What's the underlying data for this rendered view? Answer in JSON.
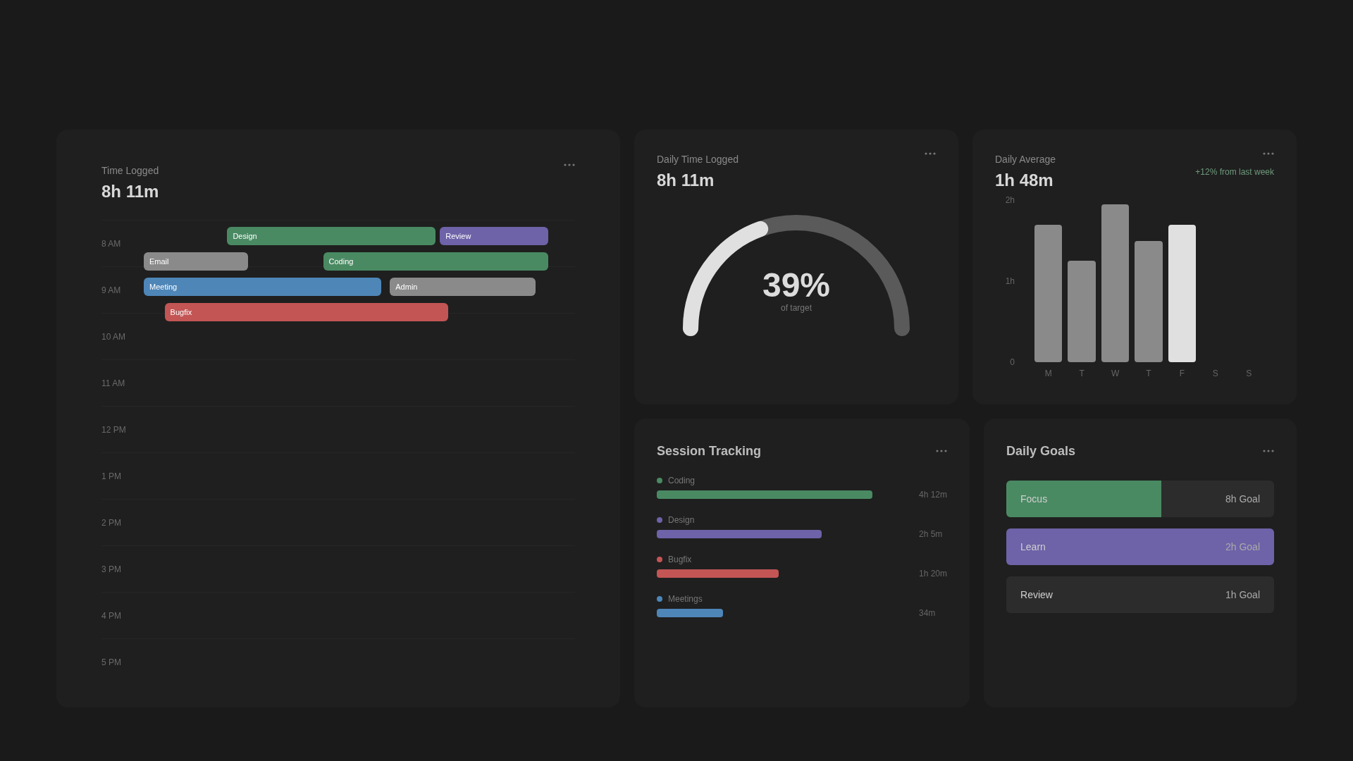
{
  "timeline": {
    "label": "Time Logged",
    "value": "8h 11m",
    "hours": [
      "8 AM",
      "9 AM",
      "10 AM",
      "11 AM",
      "12 PM",
      "1 PM",
      "2 PM",
      "3 PM",
      "4 PM",
      "5 PM"
    ],
    "rows": [
      {
        "events": [
          {
            "label": "Design",
            "color": "#4a8a63"
          },
          {
            "label": "Review",
            "color": "#6e62a8"
          }
        ]
      },
      {
        "events": [
          {
            "label": "Email",
            "color": "#8a8a8a"
          },
          {
            "label": "Coding",
            "color": "#4a8a63"
          }
        ]
      },
      {
        "events": [
          {
            "label": "Meeting",
            "color": "#4e86b8"
          },
          {
            "label": "Admin",
            "color": "#8a8a8a"
          }
        ]
      },
      {
        "events": [
          {
            "label": "Bugfix",
            "color": "#c35555"
          }
        ]
      }
    ]
  },
  "gauge": {
    "label": "Daily Time Logged",
    "value": "8h 11m",
    "percent": "39%",
    "caption": "of target"
  },
  "average": {
    "label": "Daily Average",
    "value": "1h 48m",
    "trend": "+12% from last week",
    "chart_data": {
      "type": "bar",
      "categories": [
        "M",
        "T",
        "W",
        "T",
        "F",
        "S",
        "S"
      ],
      "series": [
        {
          "color": "#8a8a8a",
          "values": [
            1.7,
            1.25,
            1.95,
            1.5,
            null,
            null,
            null
          ]
        },
        {
          "color": "#e0e0e0",
          "values": [
            null,
            null,
            null,
            null,
            1.7,
            null,
            null
          ]
        }
      ],
      "ylim": [
        0,
        2
      ],
      "yticks": [
        {
          "value": 0,
          "label": "0"
        },
        {
          "value": 1,
          "label": "1h"
        },
        {
          "value": 2,
          "label": "2h"
        }
      ]
    }
  },
  "sessions": {
    "title": "Session Tracking",
    "items": [
      {
        "name": "Coding",
        "reading": "4h 12m",
        "color": "#4a8a63"
      },
      {
        "name": "Design",
        "reading": "2h 5m",
        "color": "#6e62a8"
      },
      {
        "name": "Bugfix",
        "reading": "1h 20m",
        "color": "#c35555"
      },
      {
        "name": "Meetings",
        "reading": "34m",
        "color": "#4e86b8"
      }
    ]
  },
  "goals": {
    "title": "Daily Goals",
    "items": [
      {
        "name": "Focus",
        "target": "8h Goal",
        "color": "#4a8a63",
        "level": 0.58
      },
      {
        "name": "Learn",
        "target": "2h Goal",
        "color": "#6e62a8",
        "level": 1
      },
      {
        "name": "Review",
        "target": "1h Goal"
      }
    ]
  }
}
